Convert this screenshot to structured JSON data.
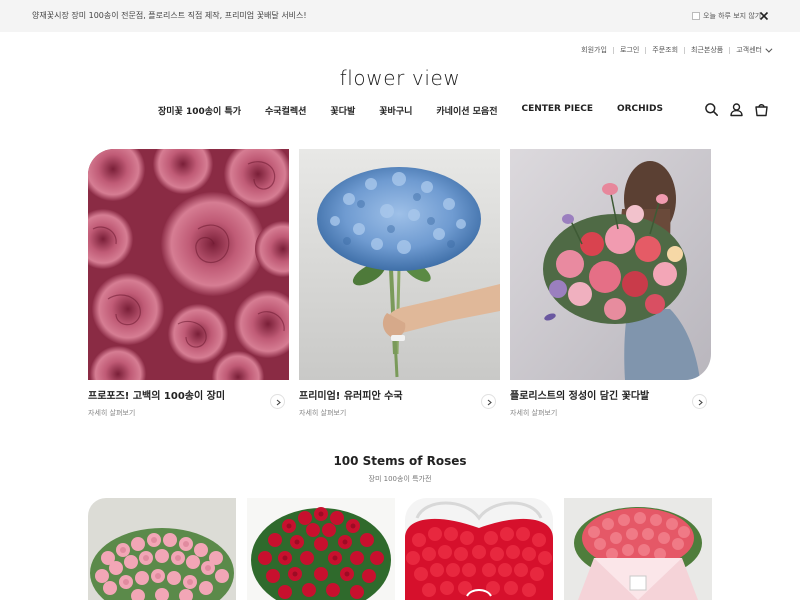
{
  "notice": {
    "text": "양재꽃시장 장미 100송이 전문점, 플로리스트 직접 제작, 프리미엄 꽃배달 서비스!",
    "dismiss_today_label": "오늘 하루 보지 않기"
  },
  "utility_links": [
    "회원가입",
    "로그인",
    "주문조회",
    "최근본상품",
    "고객센터"
  ],
  "logo": {
    "text": "flower view"
  },
  "nav": {
    "items": [
      "장미꽃 100송이 특가",
      "수국컬렉션",
      "꽃다발",
      "꽃바구니",
      "카네이션 모음전",
      "CENTER PIECE",
      "ORCHIDS"
    ],
    "icons": [
      "search-icon",
      "user-icon",
      "cart-icon"
    ]
  },
  "features": [
    {
      "title": "프로포즈! 고백의 100송이 장미",
      "link": "자세히 살펴보기"
    },
    {
      "title": "프리미엄! 유러피안 수국",
      "link": "자세히 살펴보기"
    },
    {
      "title": "플로리스트의 정성이 담긴 꽃다발",
      "link": "자세히 살펴보기"
    }
  ],
  "section": {
    "title": "100 Stems of Roses",
    "subtitle": "장미 100송이 특가전"
  },
  "colors": {
    "accent": "#c7432f",
    "notice_bg": "#f4f4f4",
    "rose_pink": "#b8546d",
    "hydrangea_blue": "#6f9bd1",
    "red_rose": "#c8102e"
  }
}
